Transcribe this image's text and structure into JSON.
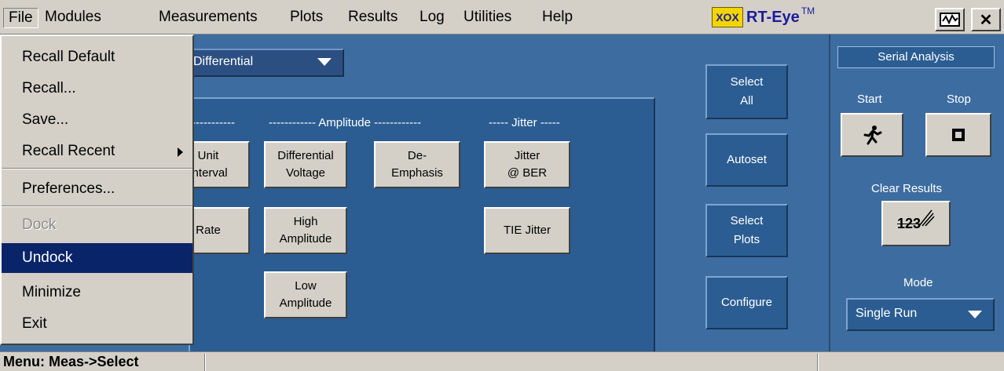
{
  "menubar": {
    "items": [
      "File",
      "Modules",
      "Measurements",
      "Plots",
      "Results",
      "Log",
      "Utilities",
      "Help"
    ],
    "brand_logo": "XOX",
    "brand_name": "RT-Eye",
    "brand_tm": "TM"
  },
  "window_buttons": {
    "restore_icon": "restore-icon",
    "close_label": "✕"
  },
  "signal_type": {
    "value": "Differential"
  },
  "section_headers": {
    "timing": "-----------",
    "amplitude": "------------ Amplitude ------------",
    "jitter": "----- Jitter -----"
  },
  "measurements": {
    "unit_interval": [
      "Unit",
      "Interval"
    ],
    "rate": "Rate",
    "differential_voltage": [
      "Differential",
      "Voltage"
    ],
    "high_amplitude": [
      "High",
      "Amplitude"
    ],
    "low_amplitude": [
      "Low",
      "Amplitude"
    ],
    "de_emphasis": [
      "De-",
      "Emphasis"
    ],
    "jitter_ber": [
      "Jitter",
      "@ BER"
    ],
    "tie_jitter": "TIE Jitter"
  },
  "side_buttons": {
    "select_all": [
      "Select",
      "All"
    ],
    "autoset": "Autoset",
    "select_plots": [
      "Select",
      "Plots"
    ],
    "configure": "Configure"
  },
  "right_panel": {
    "title": "Serial Analysis",
    "start_label": "Start",
    "stop_label": "Stop",
    "clear_results_label": "Clear Results",
    "clear_icon_text": "123",
    "mode_label": "Mode",
    "mode_value": "Single Run"
  },
  "file_menu": {
    "items": [
      {
        "label": "Recall Default"
      },
      {
        "label": "Recall..."
      },
      {
        "label": "Save..."
      },
      {
        "label": "Recall Recent"
      },
      {
        "label": "Preferences..."
      },
      {
        "label": "Dock"
      },
      {
        "label": "Undock"
      },
      {
        "label": "Minimize"
      },
      {
        "label": "Exit"
      }
    ]
  },
  "status": {
    "text": "Menu: Meas->Select"
  },
  "colors": {
    "panel_blue": "#3d6da0",
    "box_blue": "#2b5d92",
    "menu_gray": "#d4d0c8",
    "highlight": "#0a246a",
    "brand_yellow": "#f3d500"
  }
}
